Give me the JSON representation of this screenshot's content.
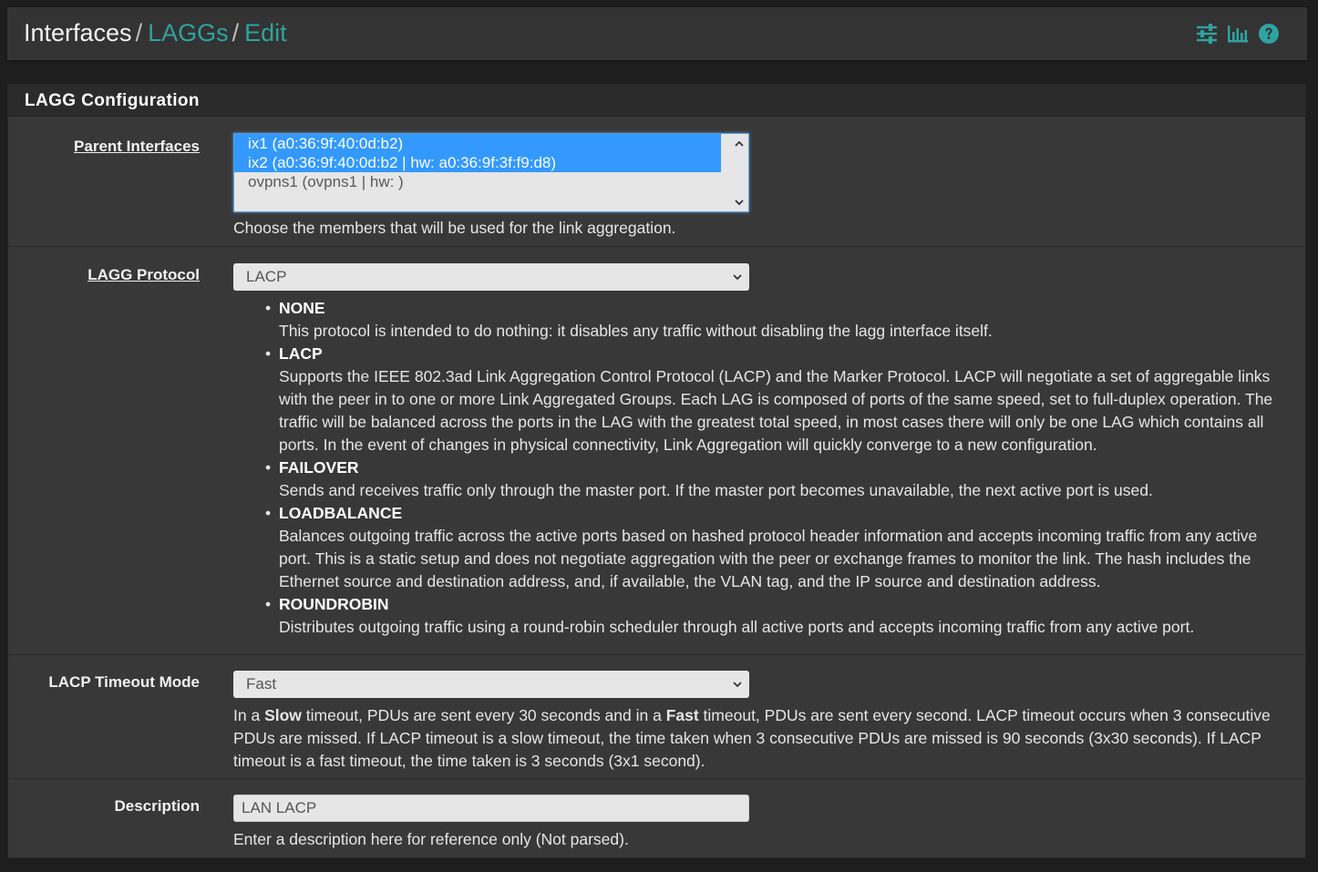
{
  "breadcrumb": {
    "root": "Interfaces",
    "link1": "LAGGs",
    "link2": "Edit",
    "sep": "/"
  },
  "header_icons": [
    "sliders-icon",
    "bar-chart-icon",
    "help-icon"
  ],
  "colors": {
    "accent": "#2fa3a0",
    "selected": "#3399ff",
    "background": "#1e1e1e",
    "panel": "#383838"
  },
  "panel": {
    "title": "LAGG Configuration",
    "parent_interfaces": {
      "label": "Parent Interfaces",
      "options": [
        {
          "text": "ix1 (a0:36:9f:40:0d:b2)",
          "selected": true
        },
        {
          "text": "ix2 (a0:36:9f:40:0d:b2 | hw: a0:36:9f:3f:f9:d8)",
          "selected": true
        },
        {
          "text": "ovpns1 (ovpns1 | hw: )",
          "selected": false
        }
      ],
      "help": "Choose the members that will be used for the link aggregation."
    },
    "lagg_protocol": {
      "label": "LAGG Protocol",
      "value": "LACP",
      "items": [
        {
          "name": "NONE",
          "desc": "This protocol is intended to do nothing: it disables any traffic without disabling the lagg interface itself."
        },
        {
          "name": "LACP",
          "desc": "Supports the IEEE 802.3ad Link Aggregation Control Protocol (LACP) and the Marker Protocol. LACP will negotiate a set of aggregable links with the peer in to one or more Link Aggregated Groups. Each LAG is composed of ports of the same speed, set to full-duplex operation. The traffic will be balanced across the ports in the LAG with the greatest total speed, in most cases there will only be one LAG which contains all ports. In the event of changes in physical connectivity, Link Aggregation will quickly converge to a new configuration."
        },
        {
          "name": "FAILOVER",
          "desc": "Sends and receives traffic only through the master port. If the master port becomes unavailable, the next active port is used."
        },
        {
          "name": "LOADBALANCE",
          "desc": "Balances outgoing traffic across the active ports based on hashed protocol header information and accepts incoming traffic from any active port. This is a static setup and does not negotiate aggregation with the peer or exchange frames to monitor the link. The hash includes the Ethernet source and destination address, and, if available, the VLAN tag, and the IP source and destination address."
        },
        {
          "name": "ROUNDROBIN",
          "desc": "Distributes outgoing traffic using a round-robin scheduler through all active ports and accepts incoming traffic from any active port."
        }
      ]
    },
    "lacp_timeout": {
      "label": "LACP Timeout Mode",
      "value": "Fast",
      "help_parts": [
        "In a ",
        "Slow",
        " timeout, PDUs are sent every 30 seconds and in a ",
        "Fast",
        " timeout, PDUs are sent every second. LACP timeout occurs when 3 consecutive PDUs are missed. If LACP timeout is a slow timeout, the time taken when 3 consecutive PDUs are missed is 90 seconds (3x30 seconds). If LACP timeout is a fast timeout, the time taken is 3 seconds (3x1 second)."
      ]
    },
    "description": {
      "label": "Description",
      "value": "LAN LACP",
      "help": "Enter a description here for reference only (Not parsed)."
    }
  }
}
